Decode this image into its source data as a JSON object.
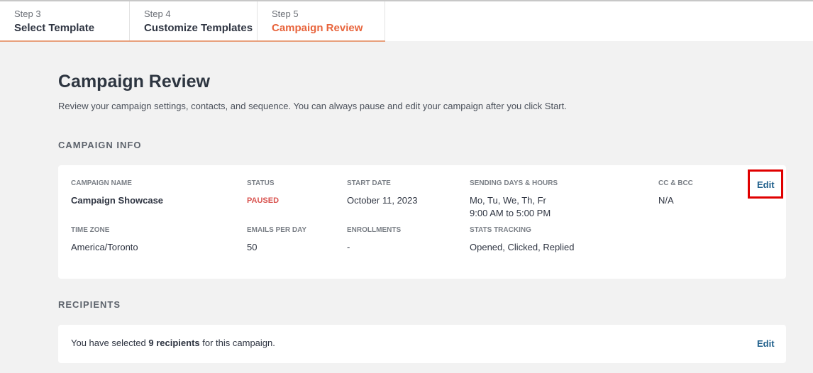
{
  "steps": [
    {
      "number": "Step 3",
      "title": "Select Template"
    },
    {
      "number": "Step 4",
      "title": "Customize Templates"
    },
    {
      "number": "Step 5",
      "title": "Campaign Review"
    }
  ],
  "page": {
    "title": "Campaign Review",
    "description": "Review your campaign settings, contacts, and sequence. You can always pause and edit your campaign after you click Start."
  },
  "campaign_info": {
    "heading": "CAMPAIGN INFO",
    "edit_label": "Edit",
    "fields": {
      "campaign_name": {
        "label": "CAMPAIGN NAME",
        "value": "Campaign Showcase"
      },
      "status": {
        "label": "STATUS",
        "value": "PAUSED"
      },
      "start_date": {
        "label": "START DATE",
        "value": "October 11, 2023"
      },
      "sending_days": {
        "label": "SENDING DAYS & HOURS",
        "value": "Mo, Tu, We, Th, Fr",
        "value2": "9:00 AM to 5:00 PM"
      },
      "cc_bcc": {
        "label": "CC & BCC",
        "value": "N/A"
      },
      "time_zone": {
        "label": "TIME ZONE",
        "value": "America/Toronto"
      },
      "emails_per_day": {
        "label": "EMAILS PER DAY",
        "value": "50"
      },
      "enrollments": {
        "label": "ENROLLMENTS",
        "value": "-"
      },
      "stats_tracking": {
        "label": "STATS TRACKING",
        "value": "Opened, Clicked, Replied"
      }
    }
  },
  "recipients": {
    "heading": "RECIPIENTS",
    "text_before": "You have selected ",
    "count_text": "9 recipients",
    "text_after": " for this campaign.",
    "edit_label": "Edit"
  },
  "colors": {
    "active_step": "#e8643c",
    "paused_status": "#d9534f",
    "link": "#1f5f8b",
    "highlight_box": "#e00000"
  }
}
